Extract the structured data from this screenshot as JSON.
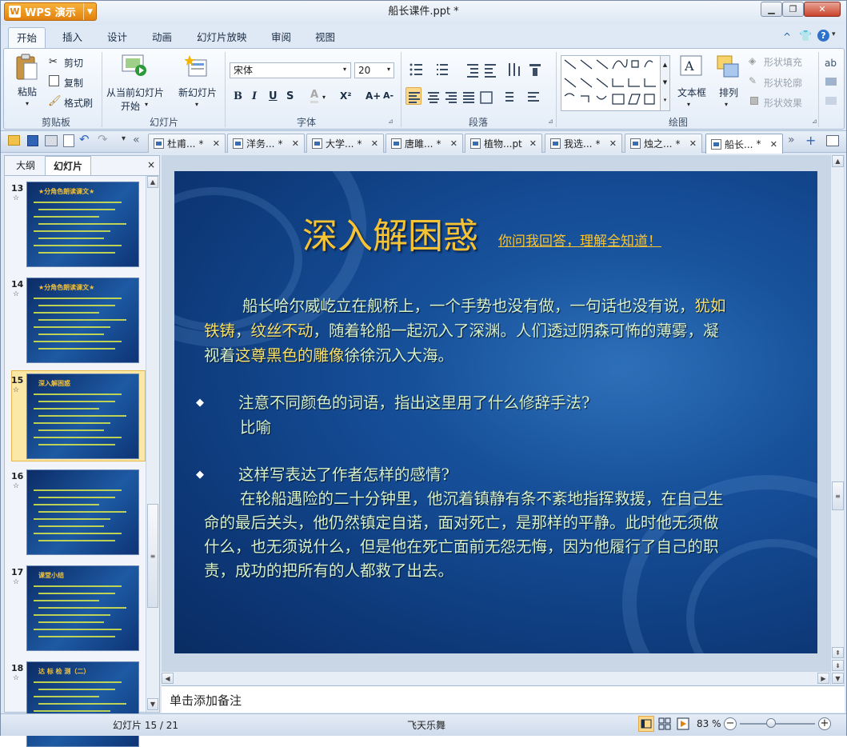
{
  "app": {
    "name": "WPS 演示",
    "title": "船长课件.ppt *"
  },
  "menu_tabs": [
    "开始",
    "插入",
    "设计",
    "动画",
    "幻灯片放映",
    "审阅",
    "视图"
  ],
  "ribbon": {
    "clipboard": {
      "paste": "粘贴",
      "cut": "剪切",
      "copy": "复制",
      "format_painter": "格式刷",
      "group": "剪贴板"
    },
    "slides": {
      "from_current": "从当前幻灯片",
      "start": "开始",
      "new_slide": "新幻灯片",
      "group": "幻灯片"
    },
    "font": {
      "name": "宋体",
      "size": "20",
      "group": "字体",
      "bold": "B",
      "italic": "I",
      "underline": "U",
      "shadow": "S",
      "color": "A",
      "superscript": "X²",
      "grow": "A+",
      "shrink": "A-"
    },
    "paragraph": {
      "group": "段落"
    },
    "drawing": {
      "textbox": "文本框",
      "arrange": "排列",
      "shape_fill": "形状填充",
      "shape_outline": "形状轮廓",
      "shape_effect": "形状效果",
      "group": "绘图"
    }
  },
  "doc_tabs": [
    {
      "label": "杜甫...",
      "mod": "*"
    },
    {
      "label": "洋务...",
      "mod": "*"
    },
    {
      "label": "大学...",
      "mod": "*"
    },
    {
      "label": "唐雎...",
      "mod": "*"
    },
    {
      "label": "植物...pt",
      "mod": ""
    },
    {
      "label": "我选...",
      "mod": "*"
    },
    {
      "label": "烛之...",
      "mod": "*"
    },
    {
      "label": "船长...",
      "mod": "*"
    }
  ],
  "left_panel": {
    "tab_outline": "大纲",
    "tab_slides": "幻灯片",
    "close": "×"
  },
  "thumbnails": [
    {
      "num": "13",
      "title": "★分角色朗读课文★"
    },
    {
      "num": "14",
      "title": "★分角色朗读课文★"
    },
    {
      "num": "15",
      "title": "深入解困惑"
    },
    {
      "num": "16",
      "title": ""
    },
    {
      "num": "17",
      "title": "课堂小结"
    },
    {
      "num": "18",
      "title": "达 标 检 测（二）"
    }
  ],
  "slide": {
    "title": "深入解困惑",
    "subtitle": "你问我回答，理解全知道！",
    "para1_a": "船长哈尔威屹立在舰桥上，一个手势也没有做，一句话也没有说，",
    "para1_hl1": "犹如",
    "para1_b_hl": "铁铸",
    "para1_c": "，",
    "para1_d_hl": "纹丝不动",
    "para1_e": "，随着轮船一起沉入了深渊。人们透过阴森可怖的薄雾，凝",
    "para1_f": "视着",
    "para1_g_hl": "这尊黑色的雕像",
    "para1_h": "徐徐沉入大海。",
    "q1": "注意不同颜色的词语，指出这里用了什么修辞手法?",
    "a1": "比喻",
    "q2": "这样写表达了作者怎样的感情?",
    "a2_l1": "在轮船遇险的二十分钟里，他沉着镇静有条不紊地指挥救援，在自己生",
    "a2_l2": "命的最后关头，他仍然镇定自诺，面对死亡，是那样的平静。此时他无须做",
    "a2_l3": "什么，也无须说什么，但是他在死亡面前无怨无悔，因为他履行了自己的职",
    "a2_l4": "责，成功的把所有的人都救了出去。"
  },
  "notes_placeholder": "单击添加备注",
  "status": {
    "slide_counter": "幻灯片 15 / 21",
    "theme": "飞天乐舞",
    "zoom": "83 %"
  },
  "colors": {
    "accent_orange": "#e2810d",
    "slide_title": "#f6c334",
    "slide_text": "#d6f1c9",
    "highlight_text": "#f7e06a"
  }
}
